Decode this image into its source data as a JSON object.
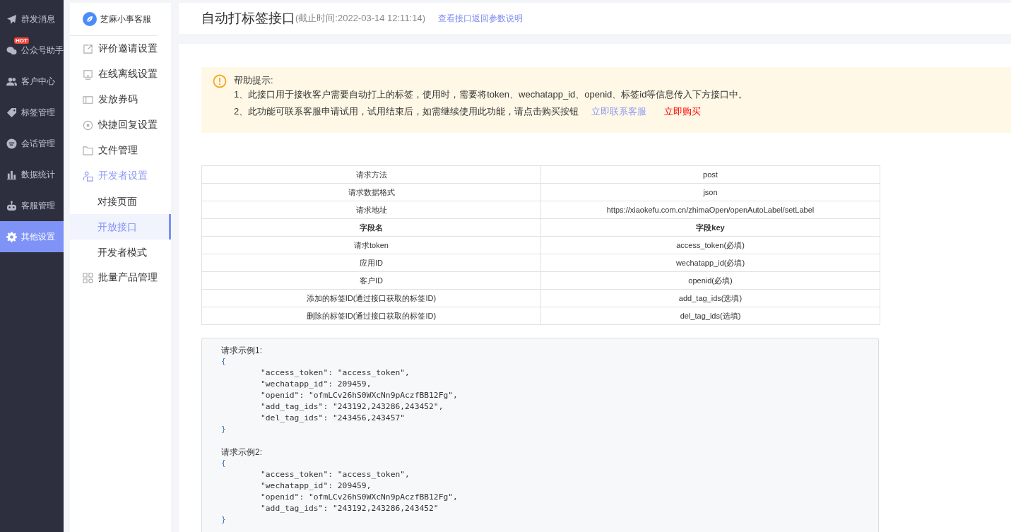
{
  "nav": [
    {
      "label": "群发消息",
      "selected": false
    },
    {
      "label": "公众号助手",
      "selected": false,
      "badge": "HOT"
    },
    {
      "label": "客户中心",
      "selected": false
    },
    {
      "label": "标签管理",
      "selected": false
    },
    {
      "label": "会话管理",
      "selected": false
    },
    {
      "label": "数据统计",
      "selected": false
    },
    {
      "label": "客服管理",
      "selected": false
    },
    {
      "label": "其他设置",
      "selected": true
    }
  ],
  "brand": {
    "name": "芝麻小事客服"
  },
  "menu": [
    {
      "label": "评价邀请设置"
    },
    {
      "label": "在线离线设置"
    },
    {
      "label": "发放券码"
    },
    {
      "label": "快捷回复设置"
    },
    {
      "label": "文件管理"
    },
    {
      "label": "开发者设置",
      "expanded": true,
      "children": [
        {
          "label": "对接页面",
          "selected": false
        },
        {
          "label": "开放接口",
          "selected": true
        },
        {
          "label": "开发者模式",
          "selected": false
        }
      ]
    },
    {
      "label": "批量产品管理"
    }
  ],
  "header": {
    "title": "自动打标签接口",
    "deadline": "(截止时间:2022-03-14  12:11:14)",
    "link": "查看接口返回参数说明"
  },
  "help": {
    "title": "帮助提示:",
    "line_1": "1、此接口用于接收客户需要自动打上的标签，使用时，需要将token、wechatapp_id、openid、标签id等信息传入下方接口中。",
    "line_2": "2、此功能可联系客服申请试用，试用结束后，如需继续使用此功能，请点击购买按钮",
    "contact_link": "立即联系客服",
    "buy_link": "立即购买"
  },
  "table": {
    "rows": [
      {
        "kind": "data",
        "name": "请求方法",
        "value": "post"
      },
      {
        "kind": "data",
        "name": "请求数据格式",
        "value": "json"
      },
      {
        "kind": "data",
        "name": "请求地址",
        "value": "https://xiaokefu.com.cn/zhimaOpen/openAutoLabel/setLabel"
      },
      {
        "kind": "header",
        "name": "字段名",
        "value": "字段key"
      },
      {
        "kind": "data",
        "name": "请求token",
        "value": "access_token(必填)"
      },
      {
        "kind": "data",
        "name": "应用ID",
        "value": "wechatapp_id(必填)"
      },
      {
        "kind": "data",
        "name": "客户ID",
        "value": "openid(必填)"
      },
      {
        "kind": "data",
        "name": "添加的标签ID(通过接口获取的标签ID)",
        "value": "add_tag_ids(选填)"
      },
      {
        "kind": "data",
        "name": "删除的标签ID(通过接口获取的标签ID)",
        "value": "del_tag_ids(选填)"
      }
    ]
  },
  "examples": [
    {
      "title": "请求示例1:",
      "open": "{",
      "fields": [
        "\"access_token\": \"access_token\",",
        "\"wechatapp_id\": 209459,",
        "\"openid\": \"ofmLCv26hS0WXcNn9pAczfBB12Fg\",",
        "\"add_tag_ids\": \"243192,243286,243452\",",
        "\"del_tag_ids\": \"243456,243457\""
      ],
      "close": "}"
    },
    {
      "title": "请求示例2:",
      "open": "{",
      "fields": [
        "\"access_token\": \"access_token\",",
        "\"wechatapp_id\": 209459,",
        "\"openid\": \"ofmLCv26hS0WXcNn9pAczfBB12Fg\",",
        "\"add_tag_ids\": \"243192,243286,243452\""
      ],
      "close": "}"
    }
  ]
}
